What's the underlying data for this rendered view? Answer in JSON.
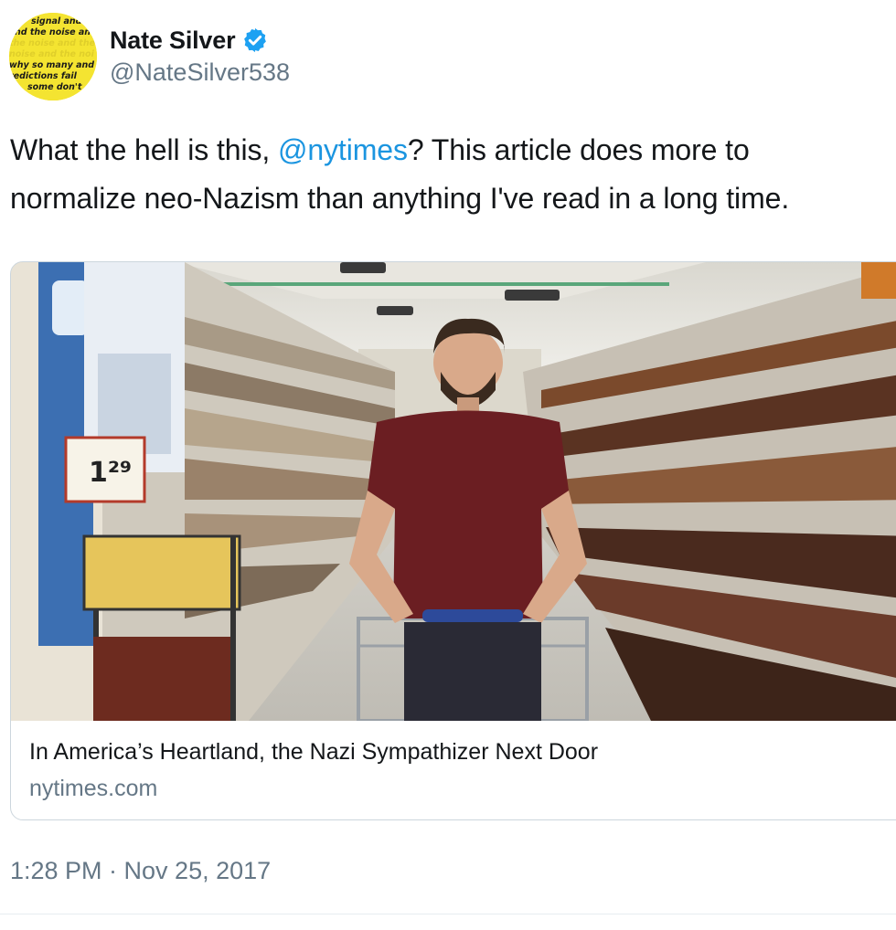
{
  "author": {
    "display_name": "Nate Silver",
    "handle": "@NateSilver538",
    "verified": true,
    "avatar_text": [
      "signal and",
      "nd the noise and",
      "the noise and the",
      "noise and the noi",
      "why so many and",
      "redictions fail",
      "some don't"
    ]
  },
  "tweet": {
    "text_before_mention": "What the hell is this, ",
    "mention": "@nytimes",
    "text_after_mention": "? This article does more to normalize neo-Nazism than anything I've read in a long time."
  },
  "card": {
    "image_alt": "man-pushing-cart-in-grocery-aisle",
    "title": "In America’s Heartland, the Nazi Sympathizer Next Door",
    "domain": "nytimes.com",
    "price_tag": "1²⁹"
  },
  "meta": {
    "timestamp": "1:28 PM · Nov 25, 2017"
  },
  "colors": {
    "link": "#1b95e0",
    "secondary_text": "#657786",
    "verified_badge": "#1da1f2",
    "avatar_bg": "#f4e431"
  }
}
